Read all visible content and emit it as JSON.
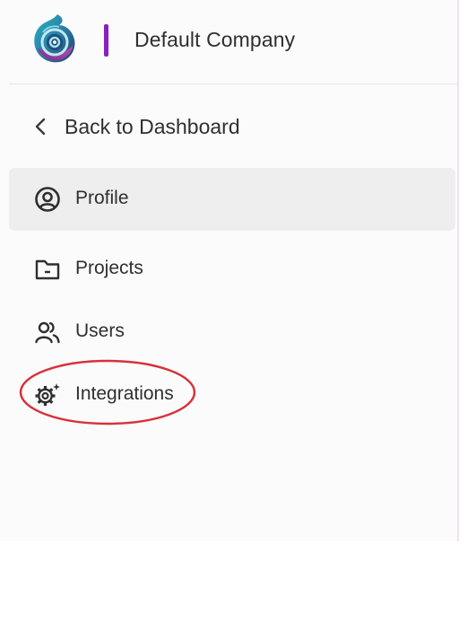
{
  "header": {
    "company_name": "Default Company",
    "logo_icon": "swirl-logo-icon",
    "accent_color": "#8a1fc0"
  },
  "nav": {
    "back_label": "Back to Dashboard",
    "items": [
      {
        "label": "Profile",
        "icon": "user-circle-icon",
        "selected": true
      },
      {
        "label": "Projects",
        "icon": "folder-icon",
        "selected": false
      },
      {
        "label": "Users",
        "icon": "users-icon",
        "selected": false
      },
      {
        "label": "Integrations",
        "icon": "gear-sparkle-icon",
        "selected": false,
        "highlighted": true
      }
    ]
  },
  "colors": {
    "panel_bg": "#fbfbfb",
    "selected_bg": "#eeeeee",
    "annotation": "#d6323a"
  }
}
